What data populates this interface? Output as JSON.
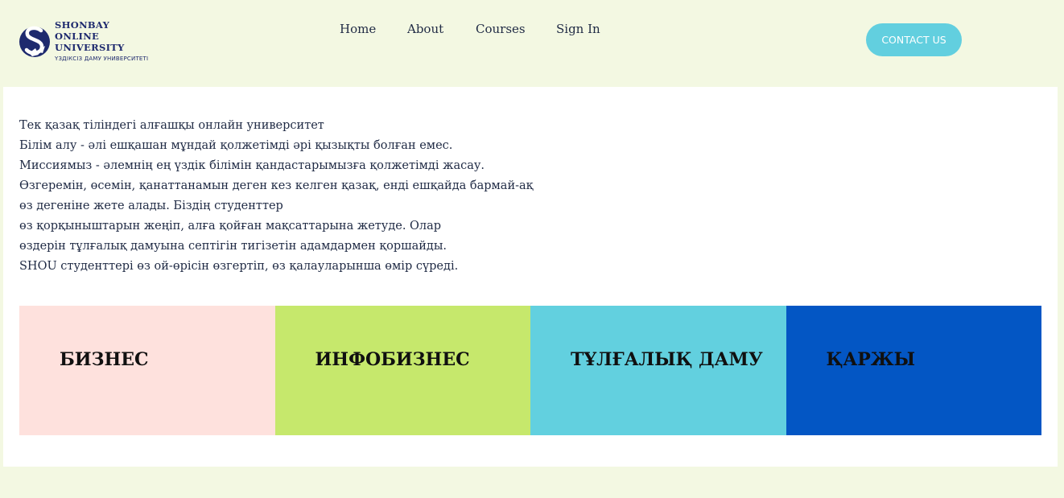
{
  "brand": {
    "line1": "SHONBAY",
    "line2": "ONLINE",
    "line3": "UNIVERSITY",
    "tagline": "ҮЗДІКСІЗ ДАМУ УНИВЕРСИТЕТІ",
    "color": "#1e2a6e",
    "icon": "eagle-s-logo-icon"
  },
  "nav": {
    "items": [
      {
        "label": "Home"
      },
      {
        "label": "About"
      },
      {
        "label": "Courses"
      },
      {
        "label": "Sign In"
      }
    ]
  },
  "contact": {
    "label": "CONTACT US",
    "color": "#62cfdf"
  },
  "intro": {
    "lines": [
      "Тек қазақ тіліндегі алғашқы онлайн университет",
      "Білім алу - әлі ешқашан мұндай қолжетімді әрі қызықты болған емес.",
      "Миссиямыз - әлемнің ең үздік білімін қандастарымызға қолжетімді жасау.",
      "Өзгеремін, өсемін, қанаттанамын деген кез келген қазақ, енді ешқайда бармай-ақ",
      "өз дегеніне жете алады. Біздің студенттер",
      "өз қорқыныштарын жеңіп, алға қойған мақсаттарына жетуде. Олар",
      "өздерін тұлғалық дамуына септігін тигізетін адамдармен қоршайды.",
      "SHOU студенттері өз ой-өрісін өзгертіп, өз қалауларынша өмір сүреді."
    ]
  },
  "tiles": [
    {
      "label": "БИЗНЕС",
      "color": "#fee1dd"
    },
    {
      "label": "ИНФОБИЗНЕС",
      "color": "#c6e86c"
    },
    {
      "label": "ТҰЛҒАЛЫҚ ДАМУ",
      "color": "#62d0df"
    },
    {
      "label": "ҚАРЖЫ",
      "color": "#0356c4"
    }
  ],
  "colors": {
    "page_background": "#f3f8e2",
    "panel_background": "#ffffff",
    "text": "#1f2a44"
  }
}
